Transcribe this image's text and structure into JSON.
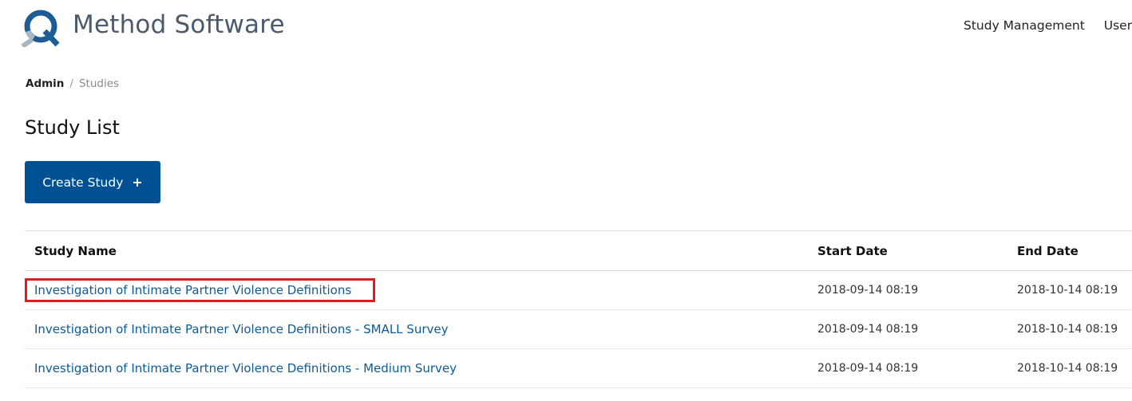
{
  "header": {
    "brand_name": "Method Software",
    "logo_icon": "q-logo-icon",
    "brand_colors": {
      "primary": "#1e5c96",
      "secondary": "#a9b7c4"
    },
    "nav": {
      "study_management": "Study Management",
      "user": "User"
    }
  },
  "breadcrumb": {
    "admin": "Admin",
    "separator": "/",
    "current": "Studies"
  },
  "page": {
    "title": "Study List",
    "create_button_label": "Create Study",
    "create_button_icon": "+",
    "accent_color": "#005194"
  },
  "table": {
    "columns": {
      "study_name": "Study Name",
      "start_date": "Start Date",
      "end_date": "End Date"
    },
    "rows": [
      {
        "name": "Investigation of Intimate Partner Violence Definitions",
        "start": "2018-09-14 08:19",
        "end": "2018-10-14 08:19",
        "highlighted": true
      },
      {
        "name": "Investigation of Intimate Partner Violence Definitions - SMALL Survey",
        "start": "2018-09-14 08:19",
        "end": "2018-10-14 08:19",
        "highlighted": false
      },
      {
        "name": "Investigation of Intimate Partner Violence Definitions - Medium Survey",
        "start": "2018-09-14 08:19",
        "end": "2018-10-14 08:19",
        "highlighted": false
      }
    ]
  },
  "highlight_color": "#e11b22"
}
